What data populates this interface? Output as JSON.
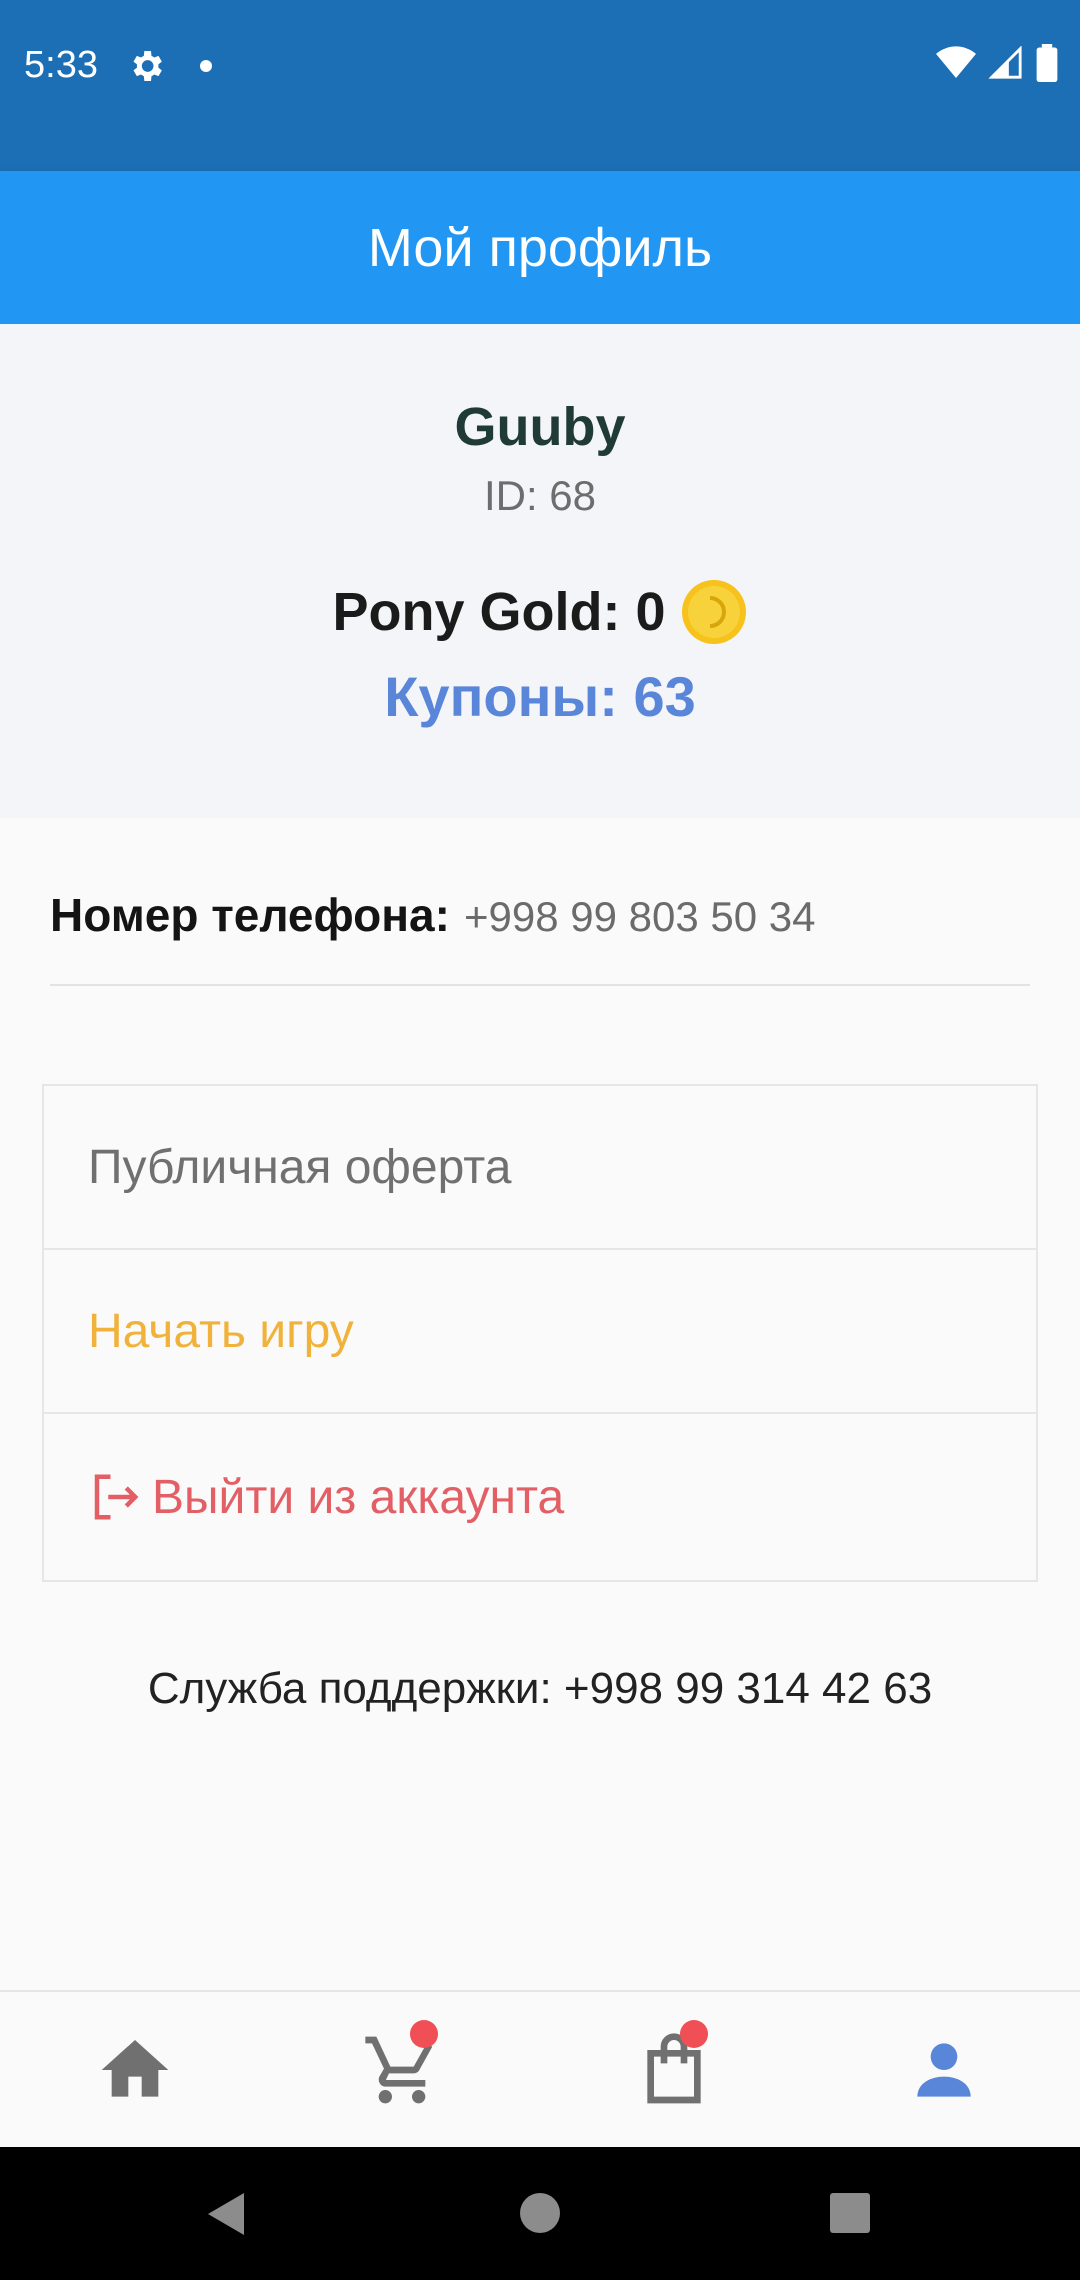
{
  "status_bar": {
    "time": "5:33"
  },
  "app_bar": {
    "title": "Мой профиль"
  },
  "profile": {
    "username": "Guuby",
    "id": "ID: 68",
    "gold": "Pony Gold: 0",
    "coupons": "Купоны: 63"
  },
  "phone": {
    "label": "Номер телефона:",
    "value": "+998 99 803 50 34"
  },
  "menu": {
    "offer": "Публичная оферта",
    "start_game": "Начать игру",
    "logout": "Выйти из аккаунта"
  },
  "support": "Служба поддержки: +998 99 314 42 63",
  "bottom_nav": {
    "items": [
      {
        "icon": "home-icon",
        "active": false,
        "badge": false
      },
      {
        "icon": "cart-icon",
        "active": false,
        "badge": true
      },
      {
        "icon": "bag-icon",
        "active": false,
        "badge": true
      },
      {
        "icon": "profile-icon",
        "active": true,
        "badge": false
      }
    ]
  },
  "colors": {
    "status_bar": "#1c6fb5",
    "app_bar": "#2196f3",
    "coupons": "#5a86d9",
    "start_game": "#f0b23a",
    "logout": "#e26065",
    "nav_active": "#5a86d9",
    "badge": "#ef4f55"
  }
}
